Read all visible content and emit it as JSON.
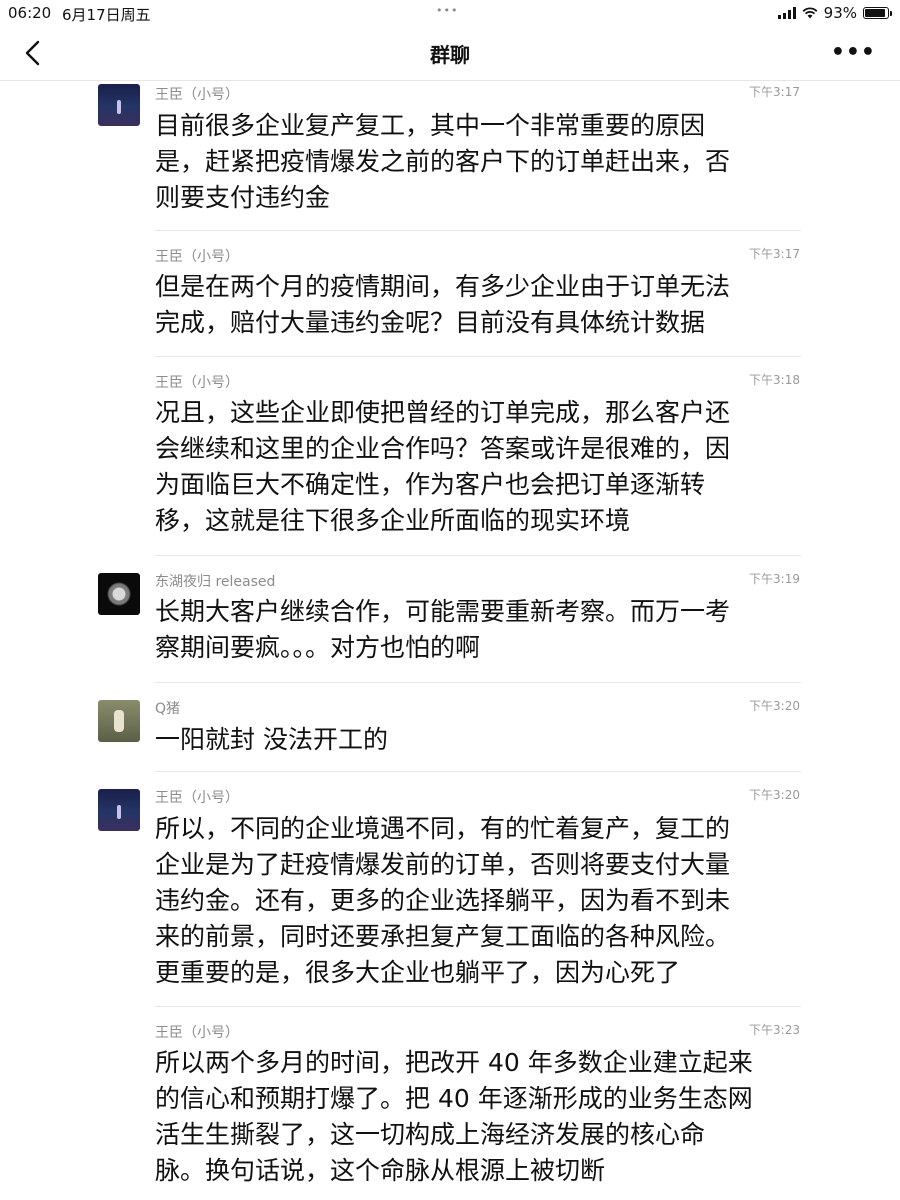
{
  "status_bar": {
    "time": "06:20",
    "date": "6月17日周五",
    "dots": "•••",
    "battery_percent": "93%",
    "battery_level": 0.93
  },
  "nav": {
    "title": "群聊",
    "more": "•••"
  },
  "messages": [
    {
      "sender": "王臣（小号）",
      "time": "下午3:17",
      "avatar": "night-sky",
      "text": "目前很多企业复产复工，其中一个非常重要的原因\n是，赶紧把疫情爆发之前的客户下的订单赶出来，否\n则要支付违约金"
    },
    {
      "sender": "王臣（小号）",
      "time": "下午3:17",
      "text": "但是在两个月的疫情期间，有多少企业由于订单无法\n完成，赔付大量违约金呢？目前没有具体统计数据"
    },
    {
      "sender": "王臣（小号）",
      "time": "下午3:18",
      "text": "况且，这些企业即使把曾经的订单完成，那么客户还\n会继续和这里的企业合作吗？答案或许是很难的，因\n为面临巨大不确定性，作为客户也会把订单逐渐转\n移，这就是往下很多企业所面临的现实环境"
    },
    {
      "sender": "东湖夜归 released",
      "time": "下午3:19",
      "avatar": "dark-flower",
      "text": "长期大客户继续合作，可能需要重新考察。而万一考\n察期间要疯。。。对方也怕的啊"
    },
    {
      "sender": "Q猪",
      "time": "下午3:20",
      "avatar": "olive-figure",
      "text": "一阳就封 没法开工的"
    },
    {
      "sender": "王臣（小号）",
      "time": "下午3:20",
      "avatar": "night-sky",
      "text": "所以，不同的企业境遇不同，有的忙着复产，复工的\n企业是为了赶疫情爆发前的订单，否则将要支付大量\n违约金。还有，更多的企业选择躺平，因为看不到未\n来的前景，同时还要承担复产复工面临的各种风险。\n更重要的是，很多大企业也躺平了，因为心死了"
    },
    {
      "sender": "王臣（小号）",
      "time": "下午3:23",
      "text": "所以两个多月的时间，把改开 40 年多数企业建立起来\n的信心和预期打爆了。把 40 年逐渐形成的业务生态网\n活生生撕裂了，这一切构成上海经济发展的核心命\n脉。换句话说，这个命脉从根源上被切断"
    }
  ]
}
